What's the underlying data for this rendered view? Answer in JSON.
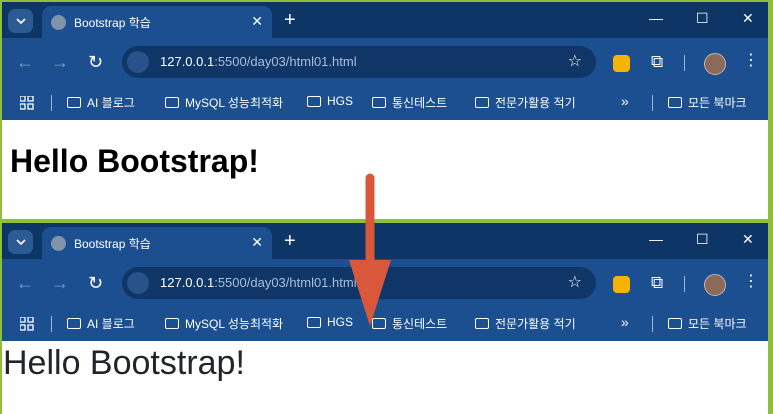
{
  "browser": {
    "tab_title": "Bootstrap 학습",
    "url_host": "127.0.0.1",
    "url_rest": ":5500/day03/html01.html",
    "bookmarks": [
      "AI 블로그",
      "MySQL 성능최적화",
      "HGS",
      "통신테스트",
      "전문가활용 적기"
    ],
    "more_bookmarks": "»",
    "all_bookmarks": "모든 북마크"
  },
  "before": {
    "heading": "Hello Bootstrap!"
  },
  "after": {
    "heading": "Hello Bootstrap!"
  },
  "colors": {
    "frame_border": "#8fbf3a",
    "tab_bar": "#0d3565",
    "toolbar": "#1b4f8f",
    "arrow": "#d9573a"
  }
}
